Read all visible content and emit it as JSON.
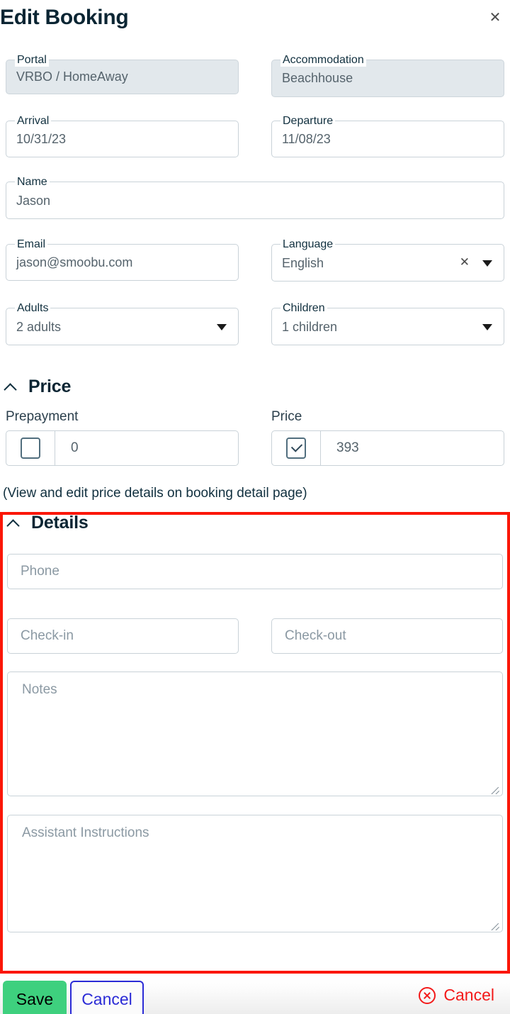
{
  "header": {
    "title": "Edit Booking",
    "close_icon": "close-icon",
    "close_glyph": "✕"
  },
  "form": {
    "portal": {
      "label": "Portal",
      "value": "VRBO / HomeAway",
      "disabled": true
    },
    "accommodation": {
      "label": "Accommodation",
      "value": "Beachhouse",
      "disabled": true
    },
    "arrival": {
      "label": "Arrival",
      "value": "10/31/23"
    },
    "departure": {
      "label": "Departure",
      "value": "11/08/23"
    },
    "name": {
      "label": "Name",
      "value": "Jason"
    },
    "email": {
      "label": "Email",
      "value": "jason@smoobu.com"
    },
    "language": {
      "label": "Language",
      "value": "English",
      "clear_icon": "clear-x-icon",
      "clear_glyph": "✕",
      "dropdown_icon": "chevron-down-icon"
    },
    "adults": {
      "label": "Adults",
      "value": "2 adults",
      "dropdown_icon": "chevron-down-icon"
    },
    "children": {
      "label": "Children",
      "value": "1 children",
      "dropdown_icon": "chevron-down-icon"
    }
  },
  "price_section": {
    "title": "Price",
    "collapse_icon": "chevron-up-icon",
    "prepayment": {
      "label": "Prepayment",
      "checked": false,
      "value": "0"
    },
    "price": {
      "label": "Price",
      "checked": true,
      "value": "393"
    },
    "note": "(View and edit price details on booking detail page)"
  },
  "details_section": {
    "title": "Details",
    "collapse_icon": "chevron-up-icon",
    "phone": {
      "placeholder": "Phone",
      "value": ""
    },
    "check_in": {
      "placeholder": "Check-in",
      "value": ""
    },
    "check_out": {
      "placeholder": "Check-out",
      "value": ""
    },
    "notes": {
      "placeholder": "Notes",
      "value": ""
    },
    "assistant_instructions": {
      "placeholder": "Assistant Instructions",
      "value": ""
    }
  },
  "footer": {
    "save_label": "Save",
    "cancel_label": "Cancel",
    "cancel_red_label": "Cancel",
    "cancel_red_icon": "x-circle-icon"
  },
  "colors": {
    "accent_title": "#0b2533",
    "highlight_border": "#fb1606",
    "save_bg": "#3ed07e",
    "cancel_outline": "#2b2bd6",
    "cancel_red": "#f31a1a",
    "field_border": "#c9d2d8",
    "disabled_bg": "#e2e8ec",
    "placeholder": "#8b99a3"
  }
}
